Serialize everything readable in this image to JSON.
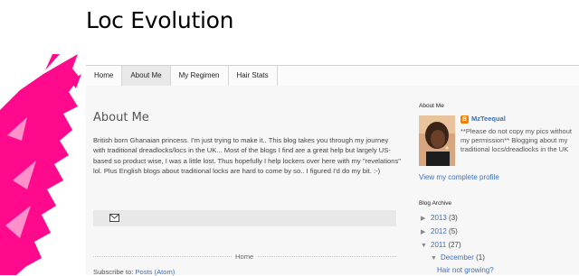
{
  "blog": {
    "title": "Loc Evolution"
  },
  "tabs": [
    {
      "label": "Home",
      "selected": false
    },
    {
      "label": "About Me",
      "selected": true
    },
    {
      "label": "My Regimen",
      "selected": false
    },
    {
      "label": "Hair Stats",
      "selected": false
    }
  ],
  "post": {
    "title": "About Me",
    "body": "British born Ghanaian princess. I'm just trying to make it.. This blog takes you through my journey with traditional dreadlocks/locs in the UK... Most of the blogs I find are a great help but largely US-based so product wise, I was a little lost. Thus hopefully I help lockers over here with my \"revelations\" lol. Plus English blogs about traditional locks are hard to come by so.. I figured I'd do my bit. :-)",
    "email_icon": "email-icon"
  },
  "navigation": {
    "home_label": "Home"
  },
  "subscribe": {
    "prefix": "Subscribe to:",
    "link": "Posts (Atom)"
  },
  "sidebar": {
    "about": {
      "title": "About Me",
      "name": "MzTeequal",
      "description": "**Please do not copy my pics without my permission** Blogging about my traditional locs/dreadlocks in the UK",
      "profile_link": "View my complete profile"
    },
    "archive": {
      "title": "Blog Archive",
      "years": [
        {
          "year": "2013",
          "count": "(3)",
          "expanded": false
        },
        {
          "year": "2012",
          "count": "(5)",
          "expanded": false
        },
        {
          "year": "2011",
          "count": "(27)",
          "expanded": true
        }
      ],
      "month": {
        "name": "December",
        "count": "(1)"
      },
      "post_link": "Hair not growing?"
    }
  },
  "colors": {
    "accent_link": "#3b6fc0",
    "splash_pink": "#ff0a8c",
    "blogger_orange": "#f57d00"
  }
}
